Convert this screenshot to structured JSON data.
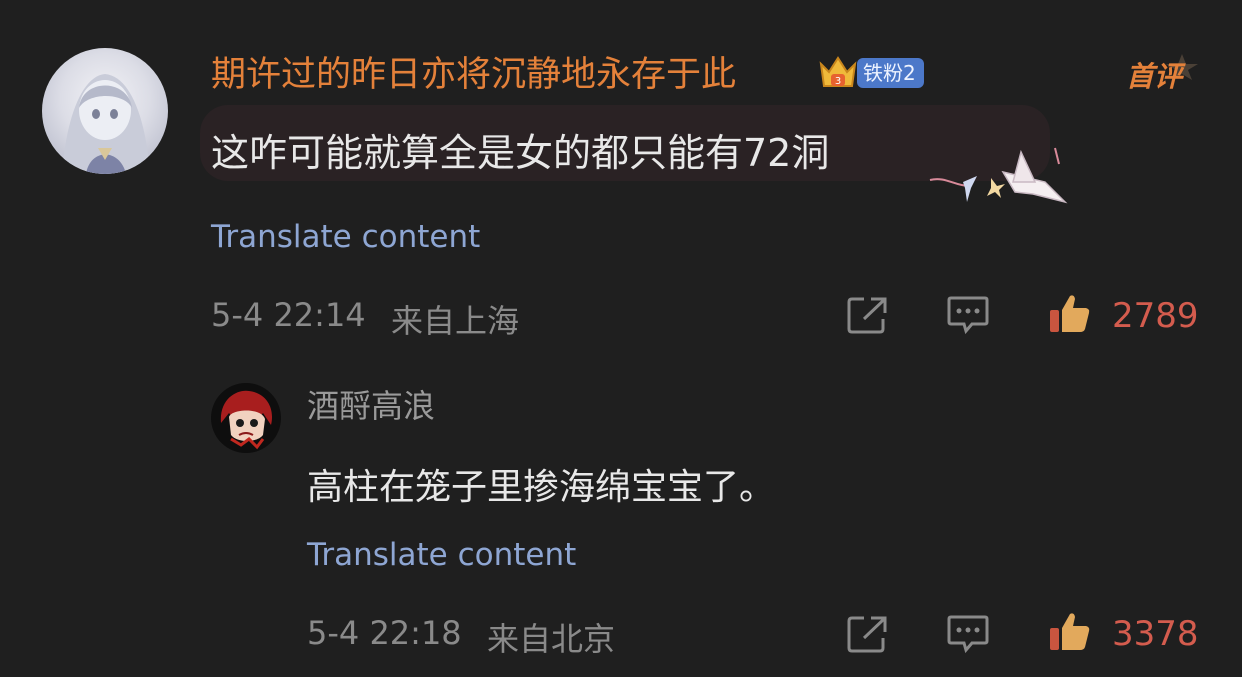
{
  "comments": [
    {
      "username": "期许过的昨日亦将沉静地永存于此",
      "fan_badge": "铁粉2",
      "text": "这咋可能就算全是女的都只能有72洞",
      "translate_label": "Translate content",
      "timestamp": "5-4 22:14",
      "location": "来自上海",
      "likes": "2789",
      "hot_label": "首评",
      "avatar_icon": "anime-girl-avatar",
      "colors": {
        "username": "#e4813a",
        "likes": "#d45c4e",
        "translate": "#8ea6d3"
      }
    },
    {
      "username": "酒酹高浪",
      "text": "高柱在笼子里掺海绵宝宝了。",
      "translate_label": "Translate content",
      "timestamp": "5-4 22:18",
      "location": "来自北京",
      "likes": "3378",
      "avatar_icon": "red-hair-character-avatar"
    }
  ],
  "icons": {
    "share": "share-icon",
    "reply": "comment-icon",
    "like": "thumbs-up-icon"
  }
}
